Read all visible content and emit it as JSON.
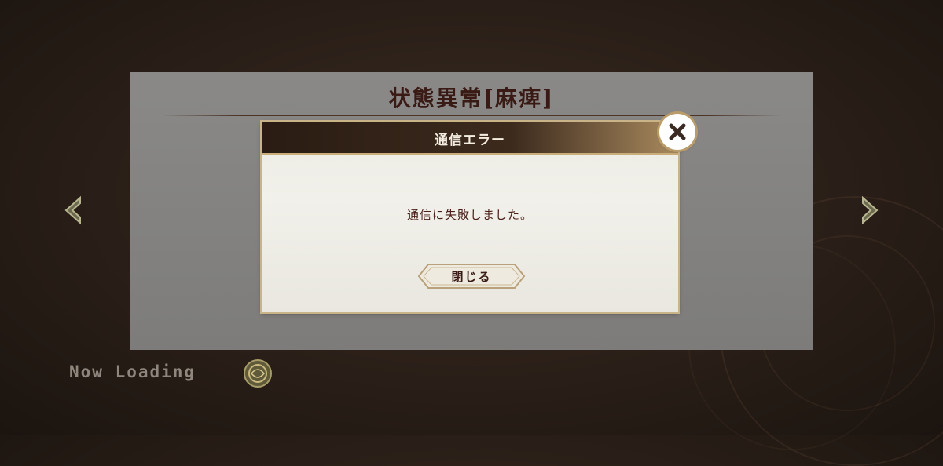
{
  "screen": {
    "panel_title": "状態異常[麻痺]",
    "loading_text": "Now Loading"
  },
  "dialog": {
    "title": "通信エラー",
    "message": "通信に失敗しました。",
    "close_button_label": "閉じる"
  },
  "icons": {
    "left_arrow": "chevron-left-icon",
    "right_arrow": "chevron-right-icon",
    "close": "close-icon",
    "loading": "loading-emblem-icon"
  },
  "colors": {
    "title_text": "#3a1a14",
    "header_dark": "#2a1c13",
    "gold_trim": "#c9ad7a",
    "dialog_bg": "#f1f0ea"
  }
}
